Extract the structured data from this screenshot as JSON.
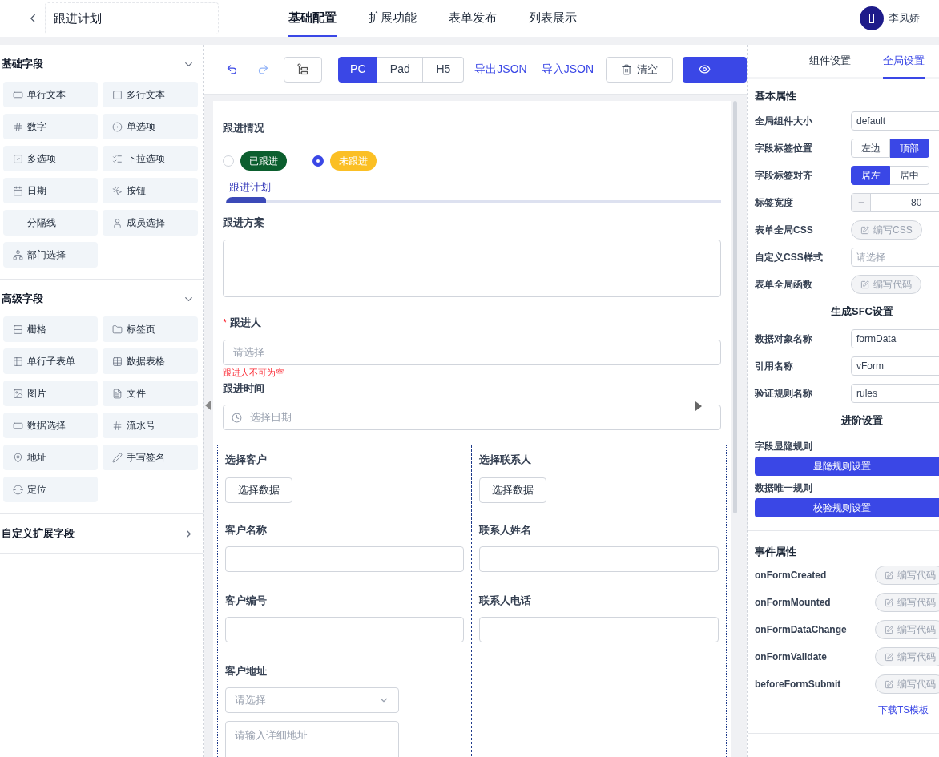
{
  "header": {
    "title": "跟进计划",
    "tabs": [
      {
        "label": "基础配置",
        "selected": true
      },
      {
        "label": "扩展功能",
        "selected": false
      },
      {
        "label": "表单发布",
        "selected": false
      },
      {
        "label": "列表展示",
        "selected": false
      }
    ],
    "user": {
      "name": "李凤娇"
    }
  },
  "sidebar": {
    "sections": [
      {
        "title": "基础字段",
        "expanded": true,
        "items": [
          {
            "label": "单行文本",
            "kind": "text"
          },
          {
            "label": "多行文本",
            "kind": "textarea"
          },
          {
            "label": "数字",
            "kind": "number"
          },
          {
            "label": "单选项",
            "kind": "radio"
          },
          {
            "label": "多选项",
            "kind": "checkbox"
          },
          {
            "label": "下拉选项",
            "kind": "select"
          },
          {
            "label": "日期",
            "kind": "date"
          },
          {
            "label": "按钮",
            "kind": "button"
          },
          {
            "label": "分隔线",
            "kind": "divider"
          },
          {
            "label": "成员选择",
            "kind": "member"
          },
          {
            "label": "部门选择",
            "kind": "department"
          }
        ]
      },
      {
        "title": "高级字段",
        "expanded": true,
        "items": [
          {
            "label": "栅格",
            "kind": "grid"
          },
          {
            "label": "标签页",
            "kind": "tabs"
          },
          {
            "label": "单行子表单",
            "kind": "subform"
          },
          {
            "label": "数据表格",
            "kind": "table"
          },
          {
            "label": "图片",
            "kind": "image"
          },
          {
            "label": "文件",
            "kind": "file"
          },
          {
            "label": "数据选择",
            "kind": "text"
          },
          {
            "label": "流水号",
            "kind": "number"
          },
          {
            "label": "地址",
            "kind": "address"
          },
          {
            "label": "手写签名",
            "kind": "signature"
          },
          {
            "label": "定位",
            "kind": "location"
          }
        ]
      },
      {
        "title": "自定义扩展字段",
        "expanded": false
      }
    ]
  },
  "toolbar": {
    "devices": [
      {
        "label": "PC",
        "selected": true
      },
      {
        "label": "Pad",
        "selected": false
      },
      {
        "label": "H5",
        "selected": false
      }
    ],
    "links": [
      "导出JSON",
      "导入JSON"
    ],
    "clear": "清空"
  },
  "form": {
    "status": {
      "label": "跟进情况",
      "options": [
        {
          "label": "已跟进",
          "selected": false,
          "color": "#0b5e2e"
        },
        {
          "label": "未跟进",
          "selected": true,
          "color": "#fbbf24"
        }
      ]
    },
    "tab": {
      "label": "跟进计划",
      "selected": true
    },
    "plan": {
      "label": "跟进方案"
    },
    "owner": {
      "label": "跟进人",
      "required": true,
      "required_mark": "*",
      "placeholder": "请选择",
      "error": "跟进人不可为空"
    },
    "time": {
      "label": "跟进时间",
      "placeholder": "选择日期"
    },
    "grid": [
      [
        {
          "kind": "button",
          "label": "选择客户",
          "button": "选择数据"
        },
        {
          "kind": "input",
          "label": "客户名称"
        },
        {
          "kind": "input",
          "label": "客户编号"
        },
        {
          "kind": "address",
          "label": "客户地址",
          "placeholder": "请选择",
          "detail_placeholder": "请输入详细地址"
        }
      ],
      [
        {
          "kind": "button",
          "label": "选择联系人",
          "button": "选择数据"
        },
        {
          "kind": "input",
          "label": "联系人姓名"
        },
        {
          "kind": "input",
          "label": "联系人电话"
        }
      ]
    ]
  },
  "settings": {
    "tabs": [
      {
        "label": "组件设置",
        "selected": false
      },
      {
        "label": "全局设置",
        "selected": true
      }
    ],
    "basic_title": "基本属性",
    "basic": [
      {
        "kind": "select",
        "label": "全局组件大小",
        "value": "default"
      },
      {
        "kind": "segmented",
        "label": "字段标签位置",
        "options": [
          {
            "label": "左边",
            "selected": false
          },
          {
            "label": "顶部",
            "selected": true
          }
        ]
      },
      {
        "kind": "segmented",
        "label": "字段标签对齐",
        "options": [
          {
            "label": "居左",
            "selected": true
          },
          {
            "label": "居中",
            "selected": false
          }
        ]
      },
      {
        "kind": "stepper",
        "label": "标签宽度",
        "value": "80"
      },
      {
        "kind": "code",
        "label": "表单全局CSS",
        "button": "编写CSS"
      },
      {
        "kind": "select",
        "label": "自定义CSS样式",
        "placeholder": "请选择"
      },
      {
        "kind": "code",
        "label": "表单全局函数",
        "button": "编写代码"
      }
    ],
    "sfc_title": "生成SFC设置",
    "sfc": [
      {
        "kind": "input",
        "label": "数据对象名称",
        "value": "formData"
      },
      {
        "kind": "input",
        "label": "引用名称",
        "value": "vForm"
      },
      {
        "kind": "input",
        "label": "验证规则名称",
        "value": "rules"
      }
    ],
    "advanced_title": "进阶设置",
    "advanced": [
      {
        "label": "字段显隐规则",
        "button": "显隐规则设置"
      },
      {
        "label": "数据唯一规则",
        "button": "校验规则设置"
      }
    ],
    "events_title": "事件属性",
    "events": [
      {
        "name": "onFormCreated",
        "button": "编写代码"
      },
      {
        "name": "onFormMounted",
        "button": "编写代码"
      },
      {
        "name": "onFormDataChange",
        "button": "编写代码"
      },
      {
        "name": "onFormValidate",
        "button": "编写代码"
      },
      {
        "name": "beforeFormSubmit",
        "button": "编写代码"
      }
    ],
    "template_link": "下载TS模板"
  }
}
